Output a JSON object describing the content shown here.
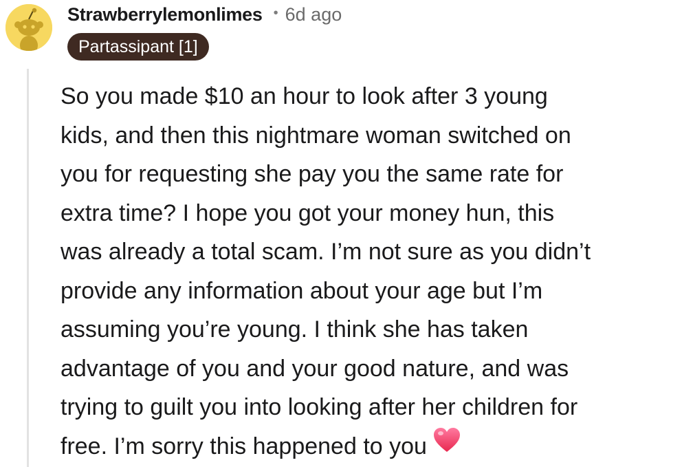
{
  "comment": {
    "username": "Strawberrylemonlimes",
    "separator": "•",
    "time_ago": "6d ago",
    "flair": "Partassipant [1]",
    "avatar_icon": "snoo-avatar-icon",
    "body_lines": [
      "So you made $10 an hour to look after 3 young",
      "kids, and then this nightmare woman switched on",
      "you for requesting she pay you the same rate for",
      "extra time? I hope you got your money hun, this",
      "was already a total scam. I’m not sure as you didn’t",
      "provide any information about your age but I’m",
      "assuming you’re young. I think she has taken",
      "advantage of you and your good nature, and was",
      "trying to guilt you into looking after her children for",
      "free. I’m sorry this happened to you"
    ],
    "emoji_icon": "pink-heart-icon"
  },
  "colors": {
    "avatar_bg": "#f7d860",
    "flair_bg": "#3f2a22",
    "heart": "#f0456f"
  }
}
